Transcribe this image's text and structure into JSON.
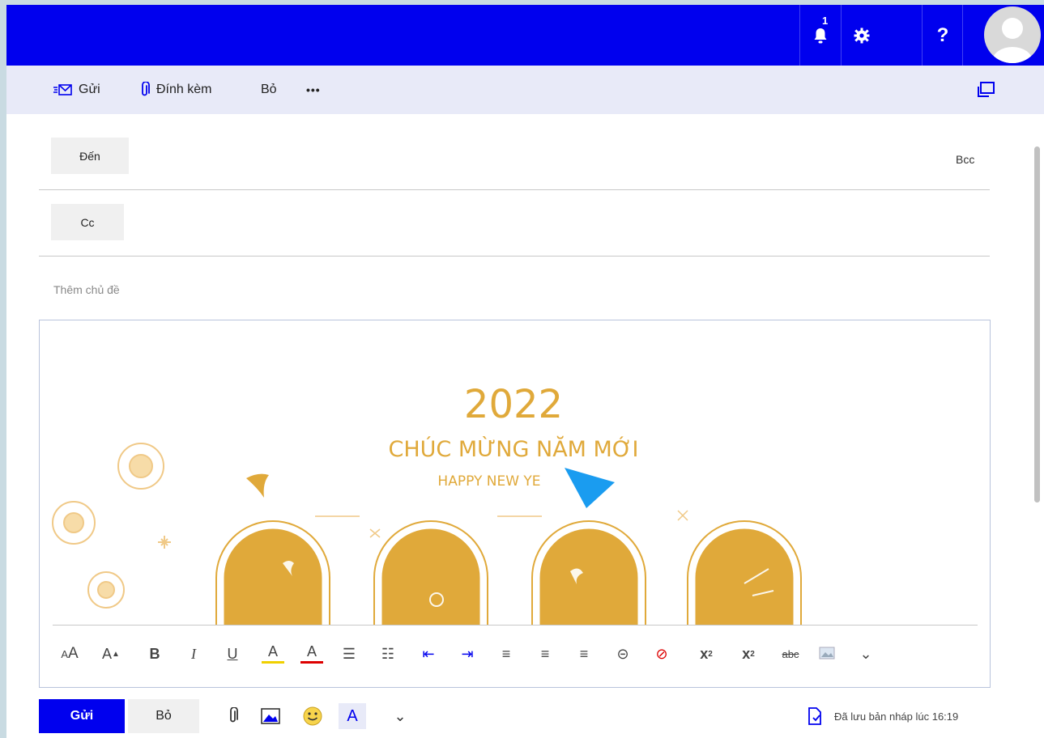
{
  "topbar": {
    "notification_count": "1",
    "icons": [
      "bell-icon",
      "gear-icon",
      "help-icon",
      "avatar"
    ]
  },
  "toolbar": {
    "send_label": "Gửi",
    "attach_label": "Đính kèm",
    "discard_label": "Bỏ",
    "more_label": "•••"
  },
  "compose": {
    "to_label": "Đến",
    "cc_label": "Cc",
    "bcc_label": "Bcc",
    "subject_placeholder": "Thêm chủ đề"
  },
  "card": {
    "year": "2022",
    "greeting_vi": "CHÚC MỪNG NĂM MỚI",
    "greeting_en": "HAPPY NEW YE"
  },
  "bottom": {
    "send_label": "Gửi",
    "discard_label": "Bỏ",
    "saved_text": "Đã lưu bản nháp lúc 16:19"
  },
  "colors": {
    "brand": "#0000ee",
    "command_bar": "#e8eaf8",
    "gold": "#e0a93a",
    "arrow": "#1a9cf0"
  }
}
